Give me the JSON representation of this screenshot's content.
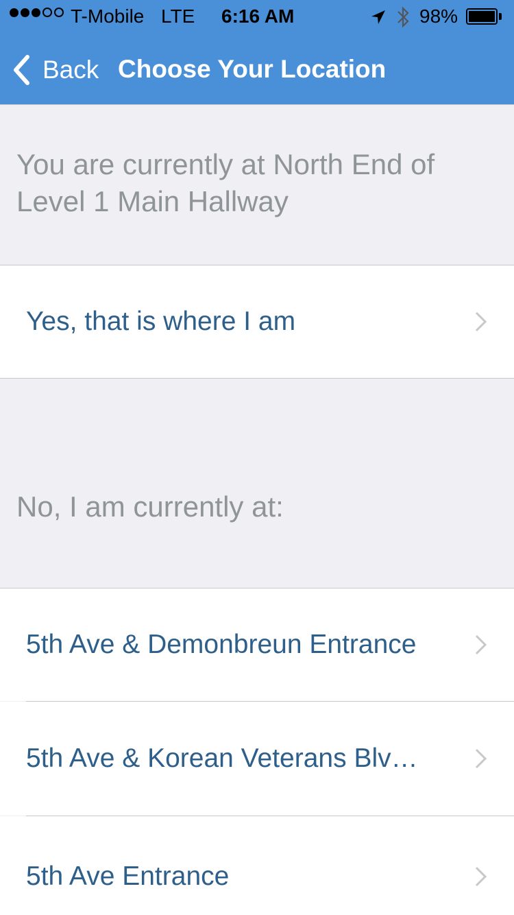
{
  "status_bar": {
    "carrier": "T-Mobile",
    "network": "LTE",
    "time": "6:16 AM",
    "battery": "98%",
    "signal_strength": 3,
    "signal_max": 5
  },
  "nav": {
    "back_label": "Back",
    "title": "Choose Your Location",
    "bar_color": "#4a90d9"
  },
  "current_location_text": "You are currently at North End of Level 1 Main Hallway",
  "confirm_option": "Yes, that is where I am",
  "alternatives_header": "No, I am currently at:",
  "locations": [
    "5th Ave & Demonbreun Entrance",
    "5th Ave & Korean Veterans Blv…",
    "5th Ave Entrance"
  ],
  "colors": {
    "link_text": "#2d5f8a",
    "header_text": "#8e9498",
    "group_background": "#efeff4"
  }
}
